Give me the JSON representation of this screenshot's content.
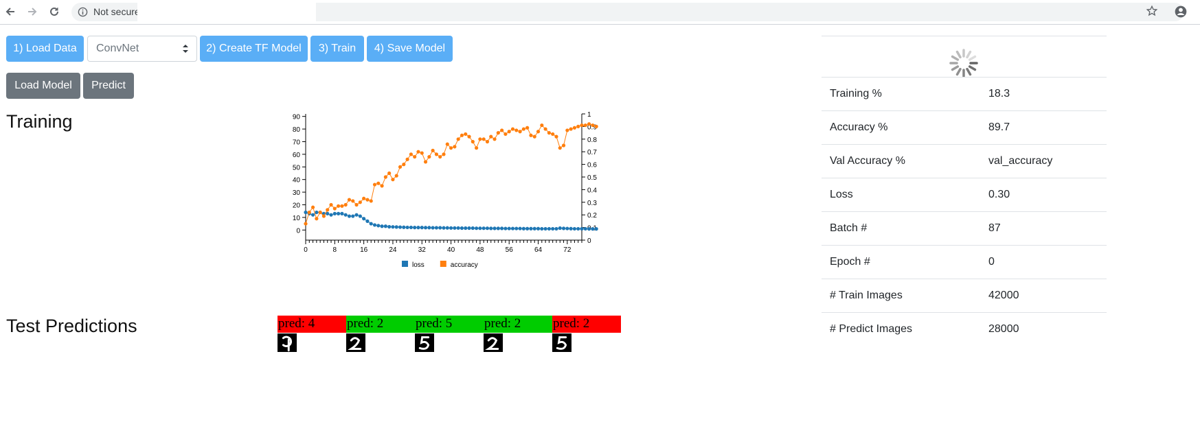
{
  "browser": {
    "address_text": "Not secure",
    "icons": [
      "back-arrow-icon",
      "forward-arrow-icon",
      "reload-icon",
      "info-icon",
      "star-icon",
      "profile-icon"
    ]
  },
  "toolbar": {
    "load_data_label": "1) Load Data",
    "model_select_value": "ConvNet",
    "create_model_label": "2) Create TF Model",
    "train_label": "3) Train",
    "save_model_label": "4) Save Model",
    "load_model_label": "Load Model",
    "predict_label": "Predict"
  },
  "colors": {
    "primary": "#5aaef6",
    "secondary": "#6c757d",
    "loss": "#1f77b4",
    "accuracy": "#ff7f0e",
    "correct": "#00cc00",
    "wrong": "#ff0000"
  },
  "sections": {
    "training_title": "Training",
    "test_predictions_title": "Test Predictions"
  },
  "chart_data": {
    "type": "line",
    "x_ticks": [
      "0",
      "8",
      "16",
      "24",
      "32",
      "40",
      "48",
      "56",
      "64",
      "72"
    ],
    "y_left_ticks": [
      "0",
      "10",
      "20",
      "30",
      "40",
      "50",
      "60",
      "70",
      "80",
      "90"
    ],
    "y_right_ticks": [
      "0",
      "0.1",
      "0.2",
      "0.3",
      "0.4",
      "0.5",
      "0.6",
      "0.7",
      "0.8",
      "0.9",
      "1"
    ],
    "xlim": [
      0,
      76
    ],
    "ylim_left": [
      -8,
      92
    ],
    "ylim_right": [
      0,
      1
    ],
    "legend_position": "bottom",
    "series": [
      {
        "name": "loss",
        "axis": "left",
        "values": [
          14,
          13,
          12,
          14,
          14,
          13,
          13,
          12,
          13,
          13,
          13,
          12,
          11,
          11,
          12,
          11,
          9,
          7,
          5,
          4,
          3.5,
          3,
          3,
          2.6,
          2.5,
          2.4,
          2.3,
          2.2,
          2.1,
          2.1,
          2.0,
          2.0,
          2.0,
          1.9,
          1.9,
          1.8,
          1.8,
          1.8,
          1.7,
          1.7,
          1.6,
          1.6,
          1.6,
          1.5,
          1.5,
          1.5,
          1.5,
          1.4,
          1.4,
          1.4,
          1.4,
          1.3,
          1.3,
          1.3,
          1.3,
          1.2,
          1.2,
          1.2,
          1.2,
          1.2,
          1.1,
          1.1,
          1.1,
          1.1,
          1.1,
          1.0,
          1.0,
          1.0,
          1.0,
          1.0,
          1.5,
          1.3,
          1.2,
          1.1,
          1.0,
          1.0,
          1.0,
          1.0,
          0.9,
          0.9,
          0.9
        ]
      },
      {
        "name": "accuracy",
        "axis": "right",
        "values": [
          0.13,
          0.22,
          0.26,
          0.17,
          0.22,
          0.19,
          0.24,
          0.28,
          0.25,
          0.27,
          0.27,
          0.28,
          0.32,
          0.31,
          0.28,
          0.3,
          0.33,
          0.32,
          0.31,
          0.44,
          0.45,
          0.43,
          0.5,
          0.53,
          0.48,
          0.51,
          0.58,
          0.6,
          0.64,
          0.68,
          0.66,
          0.7,
          0.69,
          0.62,
          0.66,
          0.71,
          0.68,
          0.66,
          0.68,
          0.76,
          0.73,
          0.74,
          0.8,
          0.83,
          0.84,
          0.82,
          0.78,
          0.73,
          0.8,
          0.8,
          0.78,
          0.82,
          0.8,
          0.85,
          0.87,
          0.84,
          0.86,
          0.88,
          0.87,
          0.86,
          0.88,
          0.89,
          0.83,
          0.82,
          0.86,
          0.91,
          0.88,
          0.85,
          0.84,
          0.82,
          0.73,
          0.75,
          0.87,
          0.88,
          0.89,
          0.9,
          0.91,
          0.91,
          0.92,
          0.91,
          0.9
        ]
      }
    ]
  },
  "predictions": [
    {
      "label": "pred: 4",
      "digit": "9",
      "correct": false
    },
    {
      "label": "pred: 2",
      "digit": "2",
      "correct": true
    },
    {
      "label": "pred: 5",
      "digit": "5",
      "correct": true
    },
    {
      "label": "pred: 2",
      "digit": "2",
      "correct": true
    },
    {
      "label": "pred: 2",
      "digit": "5",
      "correct": false
    }
  ],
  "stats": [
    {
      "label": "Training %",
      "value": "18.3"
    },
    {
      "label": "Accuracy %",
      "value": "89.7"
    },
    {
      "label": "Val Accuracy %",
      "value": "val_accuracy"
    },
    {
      "label": "Loss",
      "value": "0.30"
    },
    {
      "label": "Batch #",
      "value": "87"
    },
    {
      "label": "Epoch #",
      "value": "0"
    },
    {
      "label": "# Train Images",
      "value": "42000"
    },
    {
      "label": "# Predict Images",
      "value": "28000"
    }
  ]
}
